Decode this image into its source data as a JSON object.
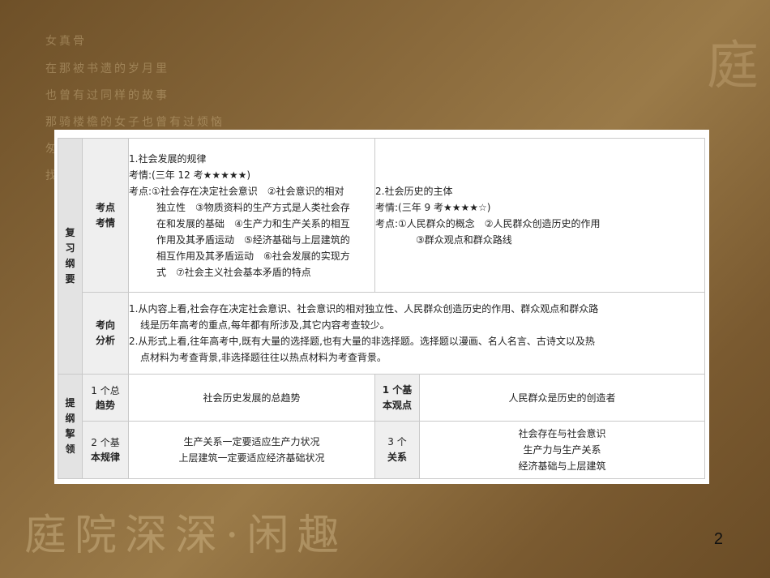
{
  "background": {
    "lines": [
      "女真骨",
      "在那被书遗的岁月里",
      "也曾有过同样的故事",
      "那骑楼檐的女子也曾有过烦恼",
      "匆",
      "找"
    ],
    "decor_text": "庭院深深·闲趣",
    "corner_glyph": "庭",
    "page_number": "2"
  },
  "review": {
    "side_label": [
      "复",
      "习",
      "纲",
      "要"
    ],
    "kaodian_label": [
      "考点",
      "考情"
    ],
    "point1": {
      "title": "1.社会发展的规律",
      "exam": "考情:(三年 12 考★★★★★)",
      "lines": [
        "考点:①社会存在决定社会意识　②社会意识的相对",
        "独立性　③物质资料的生产方式是人类社会存",
        "在和发展的基础　④生产力和生产关系的相互",
        "作用及其矛盾运动　⑤经济基础与上层建筑的",
        "相互作用及其矛盾运动　⑥社会发展的实现方",
        "式　⑦社会主义社会基本矛盾的特点"
      ]
    },
    "point2": {
      "title": "2.社会历史的主体",
      "exam": "考情:(三年 9 考★★★★☆)",
      "lines": [
        "考点:①人民群众的概念　②人民群众创造历史的作用",
        "③群众观点和群众路线"
      ]
    },
    "analysis_label": [
      "考向",
      "分析"
    ],
    "analysis": [
      "1.从内容上看,社会存在决定社会意识、社会意识的相对独立性、人民群众创造历史的作用、群众观点和群众路",
      "线是历年高考的重点,每年都有所涉及,其它内容考查较少。",
      "2.从形式上看,往年高考中,既有大量的选择题,也有大量的非选择题。选择题以漫画、名人名言、古诗文以及热",
      "点材料为考查背景,非选择题往往以热点材料为考查背景。"
    ]
  },
  "outline": {
    "side_label": [
      "提",
      "纲",
      "挈",
      "领"
    ],
    "trend_label": [
      "1 个总",
      "趋势"
    ],
    "trend_value": "社会历史发展的总趋势",
    "view_label": [
      "1 个基",
      "本观点"
    ],
    "view_value": "人民群众是历史的创造者",
    "law_label": [
      "2 个基",
      "本规律"
    ],
    "law_values": [
      "生产关系一定要适应生产力状况",
      "上层建筑一定要适应经济基础状况"
    ],
    "relation_label": [
      "3 个",
      "关系"
    ],
    "relation_values": [
      "社会存在与社会意识",
      "生产力与生产关系",
      "经济基础与上层建筑"
    ]
  }
}
